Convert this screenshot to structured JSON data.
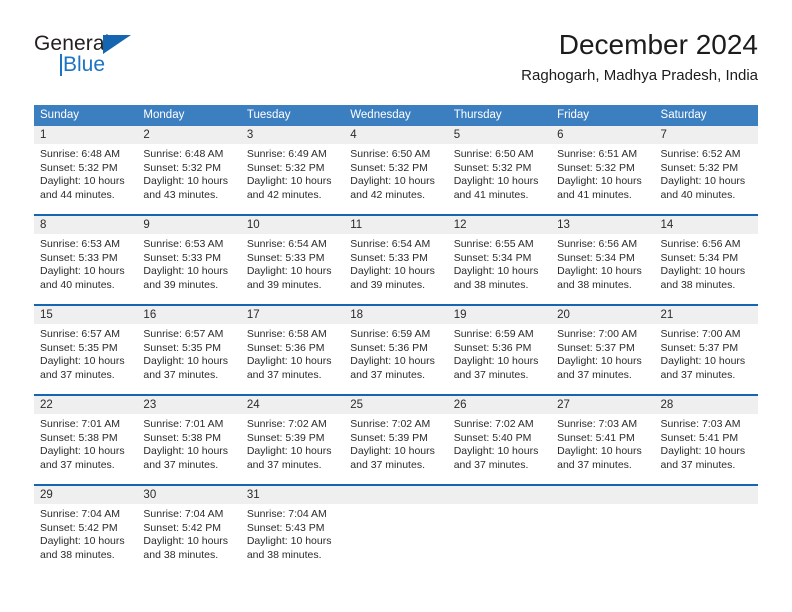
{
  "brand": {
    "name_top": "General",
    "name_bottom": "Blue",
    "accent_color": "#1b74c4",
    "triangle_color": "#1565b0"
  },
  "header": {
    "title": "December 2024",
    "subtitle": "Raghogarh, Madhya Pradesh, India"
  },
  "calendar": {
    "header_bg": "#3c7fc1",
    "row_border_color": "#1565b0",
    "day_band_bg": "#efefef",
    "weekdays": [
      "Sunday",
      "Monday",
      "Tuesday",
      "Wednesday",
      "Thursday",
      "Friday",
      "Saturday"
    ],
    "weeks": [
      [
        {
          "day": "1",
          "sunrise": "Sunrise: 6:48 AM",
          "sunset": "Sunset: 5:32 PM",
          "daylight_line1": "Daylight: 10 hours",
          "daylight_line2": "and 44 minutes."
        },
        {
          "day": "2",
          "sunrise": "Sunrise: 6:48 AM",
          "sunset": "Sunset: 5:32 PM",
          "daylight_line1": "Daylight: 10 hours",
          "daylight_line2": "and 43 minutes."
        },
        {
          "day": "3",
          "sunrise": "Sunrise: 6:49 AM",
          "sunset": "Sunset: 5:32 PM",
          "daylight_line1": "Daylight: 10 hours",
          "daylight_line2": "and 42 minutes."
        },
        {
          "day": "4",
          "sunrise": "Sunrise: 6:50 AM",
          "sunset": "Sunset: 5:32 PM",
          "daylight_line1": "Daylight: 10 hours",
          "daylight_line2": "and 42 minutes."
        },
        {
          "day": "5",
          "sunrise": "Sunrise: 6:50 AM",
          "sunset": "Sunset: 5:32 PM",
          "daylight_line1": "Daylight: 10 hours",
          "daylight_line2": "and 41 minutes."
        },
        {
          "day": "6",
          "sunrise": "Sunrise: 6:51 AM",
          "sunset": "Sunset: 5:32 PM",
          "daylight_line1": "Daylight: 10 hours",
          "daylight_line2": "and 41 minutes."
        },
        {
          "day": "7",
          "sunrise": "Sunrise: 6:52 AM",
          "sunset": "Sunset: 5:32 PM",
          "daylight_line1": "Daylight: 10 hours",
          "daylight_line2": "and 40 minutes."
        }
      ],
      [
        {
          "day": "8",
          "sunrise": "Sunrise: 6:53 AM",
          "sunset": "Sunset: 5:33 PM",
          "daylight_line1": "Daylight: 10 hours",
          "daylight_line2": "and 40 minutes."
        },
        {
          "day": "9",
          "sunrise": "Sunrise: 6:53 AM",
          "sunset": "Sunset: 5:33 PM",
          "daylight_line1": "Daylight: 10 hours",
          "daylight_line2": "and 39 minutes."
        },
        {
          "day": "10",
          "sunrise": "Sunrise: 6:54 AM",
          "sunset": "Sunset: 5:33 PM",
          "daylight_line1": "Daylight: 10 hours",
          "daylight_line2": "and 39 minutes."
        },
        {
          "day": "11",
          "sunrise": "Sunrise: 6:54 AM",
          "sunset": "Sunset: 5:33 PM",
          "daylight_line1": "Daylight: 10 hours",
          "daylight_line2": "and 39 minutes."
        },
        {
          "day": "12",
          "sunrise": "Sunrise: 6:55 AM",
          "sunset": "Sunset: 5:34 PM",
          "daylight_line1": "Daylight: 10 hours",
          "daylight_line2": "and 38 minutes."
        },
        {
          "day": "13",
          "sunrise": "Sunrise: 6:56 AM",
          "sunset": "Sunset: 5:34 PM",
          "daylight_line1": "Daylight: 10 hours",
          "daylight_line2": "and 38 minutes."
        },
        {
          "day": "14",
          "sunrise": "Sunrise: 6:56 AM",
          "sunset": "Sunset: 5:34 PM",
          "daylight_line1": "Daylight: 10 hours",
          "daylight_line2": "and 38 minutes."
        }
      ],
      [
        {
          "day": "15",
          "sunrise": "Sunrise: 6:57 AM",
          "sunset": "Sunset: 5:35 PM",
          "daylight_line1": "Daylight: 10 hours",
          "daylight_line2": "and 37 minutes."
        },
        {
          "day": "16",
          "sunrise": "Sunrise: 6:57 AM",
          "sunset": "Sunset: 5:35 PM",
          "daylight_line1": "Daylight: 10 hours",
          "daylight_line2": "and 37 minutes."
        },
        {
          "day": "17",
          "sunrise": "Sunrise: 6:58 AM",
          "sunset": "Sunset: 5:36 PM",
          "daylight_line1": "Daylight: 10 hours",
          "daylight_line2": "and 37 minutes."
        },
        {
          "day": "18",
          "sunrise": "Sunrise: 6:59 AM",
          "sunset": "Sunset: 5:36 PM",
          "daylight_line1": "Daylight: 10 hours",
          "daylight_line2": "and 37 minutes."
        },
        {
          "day": "19",
          "sunrise": "Sunrise: 6:59 AM",
          "sunset": "Sunset: 5:36 PM",
          "daylight_line1": "Daylight: 10 hours",
          "daylight_line2": "and 37 minutes."
        },
        {
          "day": "20",
          "sunrise": "Sunrise: 7:00 AM",
          "sunset": "Sunset: 5:37 PM",
          "daylight_line1": "Daylight: 10 hours",
          "daylight_line2": "and 37 minutes."
        },
        {
          "day": "21",
          "sunrise": "Sunrise: 7:00 AM",
          "sunset": "Sunset: 5:37 PM",
          "daylight_line1": "Daylight: 10 hours",
          "daylight_line2": "and 37 minutes."
        }
      ],
      [
        {
          "day": "22",
          "sunrise": "Sunrise: 7:01 AM",
          "sunset": "Sunset: 5:38 PM",
          "daylight_line1": "Daylight: 10 hours",
          "daylight_line2": "and 37 minutes."
        },
        {
          "day": "23",
          "sunrise": "Sunrise: 7:01 AM",
          "sunset": "Sunset: 5:38 PM",
          "daylight_line1": "Daylight: 10 hours",
          "daylight_line2": "and 37 minutes."
        },
        {
          "day": "24",
          "sunrise": "Sunrise: 7:02 AM",
          "sunset": "Sunset: 5:39 PM",
          "daylight_line1": "Daylight: 10 hours",
          "daylight_line2": "and 37 minutes."
        },
        {
          "day": "25",
          "sunrise": "Sunrise: 7:02 AM",
          "sunset": "Sunset: 5:39 PM",
          "daylight_line1": "Daylight: 10 hours",
          "daylight_line2": "and 37 minutes."
        },
        {
          "day": "26",
          "sunrise": "Sunrise: 7:02 AM",
          "sunset": "Sunset: 5:40 PM",
          "daylight_line1": "Daylight: 10 hours",
          "daylight_line2": "and 37 minutes."
        },
        {
          "day": "27",
          "sunrise": "Sunrise: 7:03 AM",
          "sunset": "Sunset: 5:41 PM",
          "daylight_line1": "Daylight: 10 hours",
          "daylight_line2": "and 37 minutes."
        },
        {
          "day": "28",
          "sunrise": "Sunrise: 7:03 AM",
          "sunset": "Sunset: 5:41 PM",
          "daylight_line1": "Daylight: 10 hours",
          "daylight_line2": "and 37 minutes."
        }
      ],
      [
        {
          "day": "29",
          "sunrise": "Sunrise: 7:04 AM",
          "sunset": "Sunset: 5:42 PM",
          "daylight_line1": "Daylight: 10 hours",
          "daylight_line2": "and 38 minutes."
        },
        {
          "day": "30",
          "sunrise": "Sunrise: 7:04 AM",
          "sunset": "Sunset: 5:42 PM",
          "daylight_line1": "Daylight: 10 hours",
          "daylight_line2": "and 38 minutes."
        },
        {
          "day": "31",
          "sunrise": "Sunrise: 7:04 AM",
          "sunset": "Sunset: 5:43 PM",
          "daylight_line1": "Daylight: 10 hours",
          "daylight_line2": "and 38 minutes."
        },
        {
          "day": "",
          "sunrise": "",
          "sunset": "",
          "daylight_line1": "",
          "daylight_line2": ""
        },
        {
          "day": "",
          "sunrise": "",
          "sunset": "",
          "daylight_line1": "",
          "daylight_line2": ""
        },
        {
          "day": "",
          "sunrise": "",
          "sunset": "",
          "daylight_line1": "",
          "daylight_line2": ""
        },
        {
          "day": "",
          "sunrise": "",
          "sunset": "",
          "daylight_line1": "",
          "daylight_line2": ""
        }
      ]
    ]
  }
}
